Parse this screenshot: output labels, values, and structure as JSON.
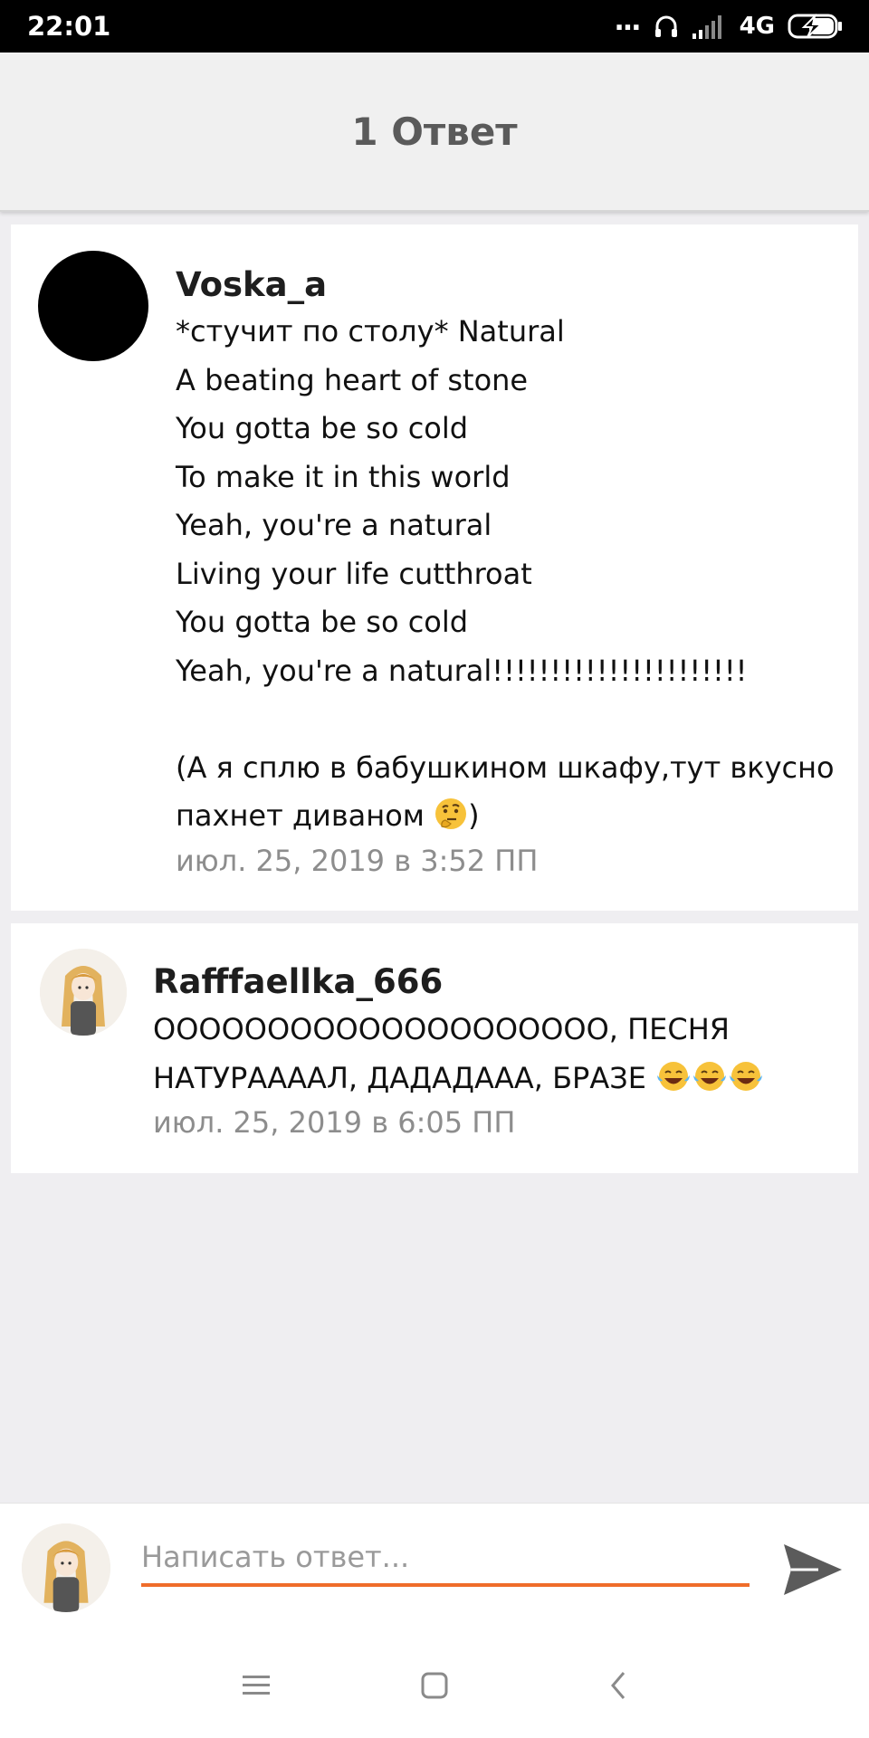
{
  "status_bar": {
    "time": "22:01",
    "dots": "...",
    "network": "4G",
    "icons": [
      "headphones-icon",
      "signal-icon",
      "battery-charging-icon"
    ]
  },
  "header": {
    "title": "1 Ответ"
  },
  "comments": [
    {
      "author": "Voska_a",
      "lines": [
        "*стучит по столу* Natural",
        "A beating heart of stone",
        "You gotta be so cold",
        "To make it in this world",
        "Yeah, you're a natural",
        "Living your life cutthroat",
        "You gotta be so cold",
        "Yeah, you're a natural!!!!!!!!!!!!!!!!!!!!!!",
        "",
        "(А я сплю в бабушкином шкафу,тут вкусно",
        "пахнет диваном",
        ")"
      ],
      "emoji": "thinking-face-emoji",
      "date": "июл. 25, 2019 в 3:52 ПП"
    },
    {
      "author": "Rafffaellka_666",
      "lines": [
        "ОООООООООООООООООООО, ПЕСНЯ",
        "НАТУРААААЛ, ДАДАДААА, БРАЗЕ"
      ],
      "emoji": "tears-of-joy-emoji",
      "date": "июл. 25, 2019 в 6:05 ПП"
    }
  ],
  "reply": {
    "placeholder": "Написать ответ...",
    "accent_color": "#ef6c2a"
  },
  "nav": {
    "icons": [
      "menu-icon",
      "home-icon",
      "back-icon"
    ]
  }
}
